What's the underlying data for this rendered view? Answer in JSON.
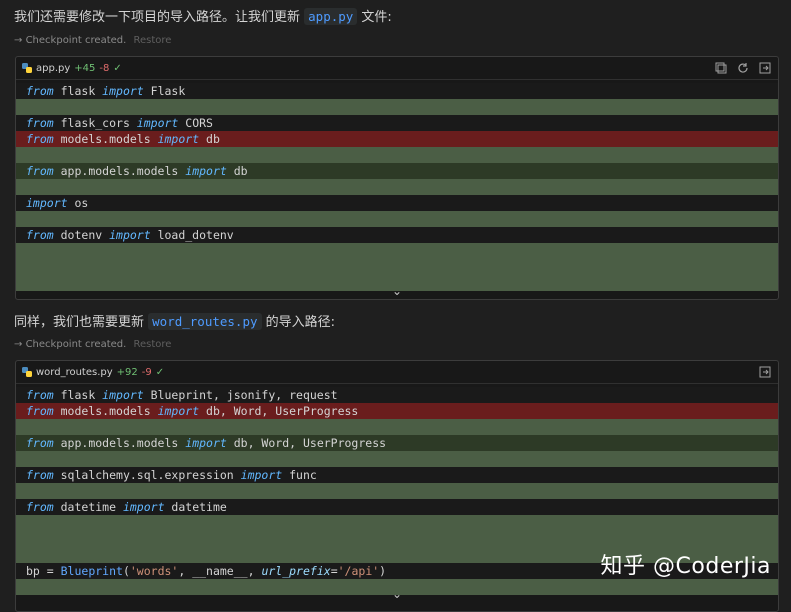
{
  "messages": [
    {
      "before": "我们还需要修改一下项目的导入路径。让我们更新 ",
      "code": "app.py",
      "after": " 文件:"
    },
    {
      "before": "同样，我们也需要更新 ",
      "code": "word_routes.py",
      "after": " 的导入路径:"
    }
  ],
  "checkpoint": {
    "text": "Checkpoint created.",
    "restore": "Restore"
  },
  "panels": [
    {
      "filename": "app.py",
      "added": "+45",
      "removed": "-8",
      "lines": [
        {
          "kind": "plain",
          "t": [
            [
              "kw",
              "from"
            ],
            [
              "",
              " flask "
            ],
            [
              "kw",
              "import"
            ],
            [
              "",
              " Flask"
            ]
          ]
        },
        {
          "kind": "add",
          "t": []
        },
        {
          "kind": "plain",
          "t": [
            [
              "kw",
              "from"
            ],
            [
              "",
              " flask_cors "
            ],
            [
              "kw",
              "import"
            ],
            [
              "",
              " CORS"
            ]
          ]
        },
        {
          "kind": "del",
          "t": [
            [
              "kw",
              "from"
            ],
            [
              "",
              " models.models "
            ],
            [
              "kw",
              "import"
            ],
            [
              "",
              " db"
            ]
          ]
        },
        {
          "kind": "add",
          "t": []
        },
        {
          "kind": "mod",
          "t": [
            [
              "kw",
              "from"
            ],
            [
              "",
              " app.models.models "
            ],
            [
              "kw",
              "import"
            ],
            [
              "",
              " db"
            ]
          ]
        },
        {
          "kind": "add",
          "t": []
        },
        {
          "kind": "plain",
          "t": [
            [
              "kw",
              "import"
            ],
            [
              "",
              " os"
            ]
          ]
        },
        {
          "kind": "add",
          "t": []
        },
        {
          "kind": "plain",
          "t": [
            [
              "kw",
              "from"
            ],
            [
              "",
              " dotenv "
            ],
            [
              "kw",
              "import"
            ],
            [
              "",
              " load_dotenv"
            ]
          ]
        },
        {
          "kind": "add",
          "t": []
        },
        {
          "kind": "add",
          "t": []
        },
        {
          "kind": "add",
          "t": []
        }
      ]
    },
    {
      "filename": "word_routes.py",
      "added": "+92",
      "removed": "-9",
      "lines": [
        {
          "kind": "plain",
          "t": [
            [
              "kw",
              "from"
            ],
            [
              "",
              " flask "
            ],
            [
              "kw",
              "import"
            ],
            [
              "",
              " Blueprint, jsonify, request"
            ]
          ]
        },
        {
          "kind": "del",
          "t": [
            [
              "kw",
              "from"
            ],
            [
              "",
              " models.models "
            ],
            [
              "kw",
              "import"
            ],
            [
              "",
              " db, Word, UserProgress"
            ]
          ]
        },
        {
          "kind": "add",
          "t": []
        },
        {
          "kind": "mod",
          "t": [
            [
              "kw",
              "from"
            ],
            [
              "",
              " app.models.models "
            ],
            [
              "kw",
              "import"
            ],
            [
              "",
              " db, Word, UserProgress"
            ]
          ]
        },
        {
          "kind": "add",
          "t": []
        },
        {
          "kind": "plain",
          "t": [
            [
              "kw",
              "from"
            ],
            [
              "",
              " sqlalchemy.sql.expression "
            ],
            [
              "kw",
              "import"
            ],
            [
              "",
              " func"
            ]
          ]
        },
        {
          "kind": "add",
          "t": []
        },
        {
          "kind": "plain",
          "t": [
            [
              "kw",
              "from"
            ],
            [
              "",
              " datetime "
            ],
            [
              "kw",
              "import"
            ],
            [
              "",
              " datetime"
            ]
          ]
        },
        {
          "kind": "add",
          "t": []
        },
        {
          "kind": "add",
          "t": []
        },
        {
          "kind": "add",
          "t": []
        },
        {
          "kind": "plain",
          "t": [
            [
              "",
              "bp = "
            ],
            [
              "fn",
              "Blueprint"
            ],
            [
              "",
              "("
            ],
            [
              "str",
              "'words'"
            ],
            [
              "",
              ", __name__, "
            ],
            [
              "prm",
              "url_prefix"
            ],
            [
              "",
              "="
            ],
            [
              "str",
              "'/api'"
            ],
            [
              "",
              ")"
            ]
          ]
        },
        {
          "kind": "add",
          "t": []
        }
      ]
    }
  ],
  "watermark": "知乎 @CoderJia",
  "colors": {
    "added_bg": "#4b5e45",
    "removed_bg": "#6a1d1d",
    "keyword": "#62b8ff",
    "link_code": "#4e9bff"
  }
}
